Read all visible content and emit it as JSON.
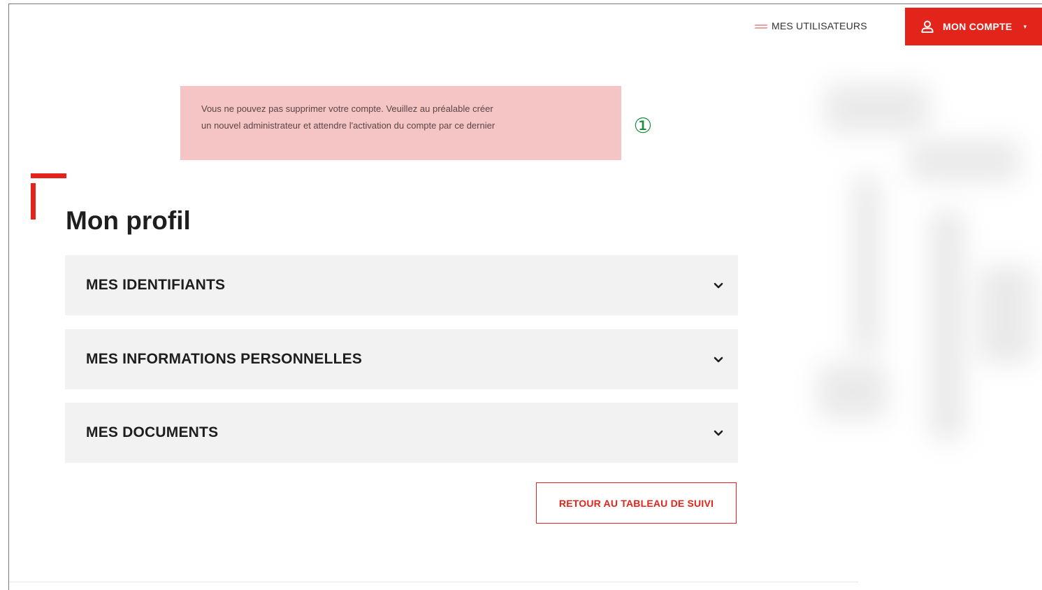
{
  "header": {
    "users_link": "MES UTILISATEURS",
    "users_icon": "users-icon",
    "account_button": "MON COMPTE",
    "account_icon": "user-icon",
    "account_caret": "▾"
  },
  "alert": {
    "line1": "Vous ne pouvez pas supprimer votre compte. Veuillez au préalable créer",
    "line2": "un nouvel administrateur et attendre l'activation du compte par ce dernier"
  },
  "annotation": {
    "number": "①",
    "color": "#1f8a3b"
  },
  "page": {
    "title": "Mon profil"
  },
  "accordion": {
    "items": [
      {
        "label": "MES IDENTIFIANTS",
        "icon": "chevron-down-icon",
        "expanded": false
      },
      {
        "label": "MES INFORMATIONS PERSONNELLES",
        "icon": "chevron-down-icon",
        "expanded": false
      },
      {
        "label": "MES DOCUMENTS",
        "icon": "chevron-down-icon",
        "expanded": false
      }
    ]
  },
  "actions": {
    "back_button": "RETOUR AU TABLEAU DE SUIVI"
  },
  "colors": {
    "brand_red": "#e3241b",
    "alert_bg": "#f5c5c5",
    "accordion_bg": "#f2f2f2"
  }
}
